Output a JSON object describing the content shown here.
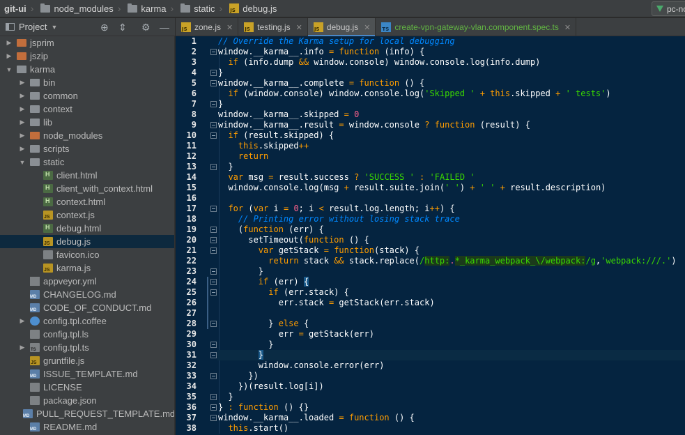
{
  "breadcrumb": [
    {
      "label": "git-ui",
      "icon": "folder-icon"
    },
    {
      "label": "node_modules",
      "icon": "folder-icon"
    },
    {
      "label": "karma",
      "icon": "folder-icon"
    },
    {
      "label": "static",
      "icon": "folder-icon"
    },
    {
      "label": "debug.js",
      "icon": "js-file-icon"
    }
  ],
  "run_config": {
    "label": "pc-node-e"
  },
  "project_panel": {
    "title": "Project",
    "tree": [
      {
        "label": "jsprim",
        "indent": 1,
        "arrow": "▶",
        "icon": "folder-orange"
      },
      {
        "label": "jszip",
        "indent": 1,
        "arrow": "▶",
        "icon": "folder-orange"
      },
      {
        "label": "karma",
        "indent": 1,
        "arrow": "▼",
        "icon": "folder-grey"
      },
      {
        "label": "bin",
        "indent": 2,
        "arrow": "▶",
        "icon": "folder-grey"
      },
      {
        "label": "common",
        "indent": 2,
        "arrow": "▶",
        "icon": "folder-grey"
      },
      {
        "label": "context",
        "indent": 2,
        "arrow": "▶",
        "icon": "folder-grey"
      },
      {
        "label": "lib",
        "indent": 2,
        "arrow": "▶",
        "icon": "folder-grey"
      },
      {
        "label": "node_modules",
        "indent": 2,
        "arrow": "▶",
        "icon": "folder-orange"
      },
      {
        "label": "scripts",
        "indent": 2,
        "arrow": "▶",
        "icon": "folder-grey"
      },
      {
        "label": "static",
        "indent": 2,
        "arrow": "▼",
        "icon": "folder-grey"
      },
      {
        "label": "client.html",
        "indent": 3,
        "arrow": "",
        "icon": "file-html"
      },
      {
        "label": "client_with_context.html",
        "indent": 3,
        "arrow": "",
        "icon": "file-html"
      },
      {
        "label": "context.html",
        "indent": 3,
        "arrow": "",
        "icon": "file-html"
      },
      {
        "label": "context.js",
        "indent": 3,
        "arrow": "",
        "icon": "file-js"
      },
      {
        "label": "debug.html",
        "indent": 3,
        "arrow": "",
        "icon": "file-html"
      },
      {
        "label": "debug.js",
        "indent": 3,
        "arrow": "",
        "icon": "file-js",
        "selected": true
      },
      {
        "label": "favicon.ico",
        "indent": 3,
        "arrow": "",
        "icon": "file-plain"
      },
      {
        "label": "karma.js",
        "indent": 3,
        "arrow": "",
        "icon": "file-js"
      },
      {
        "label": "appveyor.yml",
        "indent": 2,
        "arrow": "",
        "icon": "file-yml"
      },
      {
        "label": "CHANGELOG.md",
        "indent": 2,
        "arrow": "",
        "icon": "file-md"
      },
      {
        "label": "CODE_OF_CONDUCT.md",
        "indent": 2,
        "arrow": "",
        "icon": "file-md"
      },
      {
        "label": "config.tpl.coffee",
        "indent": 2,
        "arrow": "▶",
        "icon": "file-coffee"
      },
      {
        "label": "config.tpl.ls",
        "indent": 2,
        "arrow": "",
        "icon": "file-plain"
      },
      {
        "label": "config.tpl.ts",
        "indent": 2,
        "arrow": "▶",
        "icon": "file-ts"
      },
      {
        "label": "gruntfile.js",
        "indent": 2,
        "arrow": "",
        "icon": "file-js"
      },
      {
        "label": "ISSUE_TEMPLATE.md",
        "indent": 2,
        "arrow": "",
        "icon": "file-md"
      },
      {
        "label": "LICENSE",
        "indent": 2,
        "arrow": "",
        "icon": "file-plain"
      },
      {
        "label": "package.json",
        "indent": 2,
        "arrow": "",
        "icon": "file-json"
      },
      {
        "label": "PULL_REQUEST_TEMPLATE.md",
        "indent": 2,
        "arrow": "",
        "icon": "file-md"
      },
      {
        "label": "README.md",
        "indent": 2,
        "arrow": "",
        "icon": "file-md"
      }
    ]
  },
  "tabs": [
    {
      "label": "zone.js",
      "icon": "js",
      "active": false,
      "green": false
    },
    {
      "label": "testing.js",
      "icon": "js",
      "active": false,
      "green": false
    },
    {
      "label": "debug.js",
      "icon": "js",
      "active": true,
      "green": false
    },
    {
      "label": "create-vpn-gateway-vlan.component.spec.ts",
      "icon": "ts",
      "active": false,
      "green": true
    }
  ],
  "editor": {
    "line_numbers": [
      "1",
      "2",
      "3",
      "4",
      "5",
      "6",
      "7",
      "8",
      "9",
      "10",
      "11",
      "12",
      "13",
      "14",
      "15",
      "16",
      "17",
      "18",
      "19",
      "20",
      "21",
      "22",
      "23",
      "24",
      "25",
      "26",
      "27",
      "28",
      "29",
      "30",
      "31",
      "32",
      "33",
      "34",
      "35",
      "36",
      "37",
      "38"
    ],
    "current_line": 31,
    "fold_lines": [
      2,
      4,
      5,
      7,
      9,
      10,
      13,
      17,
      19,
      20,
      21,
      23,
      24,
      25,
      28,
      30,
      31,
      33,
      35,
      36,
      37
    ],
    "lines": [
      [
        [
          "c",
          "// Override the Karma setup for local debugging"
        ]
      ],
      [
        [
          "p",
          "window.__karma__.info "
        ],
        [
          "k",
          "="
        ],
        [
          "p",
          " "
        ],
        [
          "k",
          "function"
        ],
        [
          "p",
          " (info) {"
        ]
      ],
      [
        [
          "p",
          "  "
        ],
        [
          "k",
          "if"
        ],
        [
          "p",
          " (info.dump "
        ],
        [
          "k",
          "&&"
        ],
        [
          "p",
          " window.console) window.console.log(info.dump)"
        ]
      ],
      [
        [
          "p",
          "}"
        ]
      ],
      [
        [
          "p",
          "window.__karma__.complete "
        ],
        [
          "k",
          "="
        ],
        [
          "p",
          " "
        ],
        [
          "k",
          "function"
        ],
        [
          "p",
          " () {"
        ]
      ],
      [
        [
          "p",
          "  "
        ],
        [
          "k",
          "if"
        ],
        [
          "p",
          " (window.console) window.console.log("
        ],
        [
          "s",
          "'Skipped '"
        ],
        [
          "p",
          " "
        ],
        [
          "k",
          "+"
        ],
        [
          "p",
          " "
        ],
        [
          "k",
          "this"
        ],
        [
          "p",
          ".skipped "
        ],
        [
          "k",
          "+"
        ],
        [
          "p",
          " "
        ],
        [
          "s",
          "' tests'"
        ],
        [
          "p",
          ")"
        ]
      ],
      [
        [
          "p",
          "}"
        ]
      ],
      [
        [
          "p",
          "window.__karma__.skipped "
        ],
        [
          "k",
          "="
        ],
        [
          "p",
          " "
        ],
        [
          "n",
          "0"
        ]
      ],
      [
        [
          "p",
          "window.__karma__.result "
        ],
        [
          "k",
          "="
        ],
        [
          "p",
          " window.console "
        ],
        [
          "k",
          "?"
        ],
        [
          "p",
          " "
        ],
        [
          "k",
          "function"
        ],
        [
          "p",
          " (result) {"
        ]
      ],
      [
        [
          "p",
          "  "
        ],
        [
          "k",
          "if"
        ],
        [
          "p",
          " (result.skipped) {"
        ]
      ],
      [
        [
          "p",
          "    "
        ],
        [
          "k",
          "this"
        ],
        [
          "p",
          ".skipped"
        ],
        [
          "k",
          "++"
        ]
      ],
      [
        [
          "p",
          "    "
        ],
        [
          "k",
          "return"
        ]
      ],
      [
        [
          "p",
          "  }"
        ]
      ],
      [
        [
          "p",
          "  "
        ],
        [
          "k",
          "var"
        ],
        [
          "p",
          " msg "
        ],
        [
          "k",
          "="
        ],
        [
          "p",
          " result.success "
        ],
        [
          "k",
          "?"
        ],
        [
          "p",
          " "
        ],
        [
          "s",
          "'SUCCESS '"
        ],
        [
          "p",
          " "
        ],
        [
          "k",
          ":"
        ],
        [
          "p",
          " "
        ],
        [
          "s",
          "'FAILED '"
        ]
      ],
      [
        [
          "p",
          "  window.console.log(msg "
        ],
        [
          "k",
          "+"
        ],
        [
          "p",
          " result.suite.join("
        ],
        [
          "s",
          "' '"
        ],
        [
          "p",
          ") "
        ],
        [
          "k",
          "+"
        ],
        [
          "p",
          " "
        ],
        [
          "s",
          "' '"
        ],
        [
          "p",
          " "
        ],
        [
          "k",
          "+"
        ],
        [
          "p",
          " result.description)"
        ]
      ],
      [
        [
          "p",
          ""
        ]
      ],
      [
        [
          "p",
          "  "
        ],
        [
          "k",
          "for"
        ],
        [
          "p",
          " ("
        ],
        [
          "k",
          "var"
        ],
        [
          "p",
          " i "
        ],
        [
          "k",
          "="
        ],
        [
          "p",
          " "
        ],
        [
          "n",
          "0"
        ],
        [
          "p",
          "; i "
        ],
        [
          "k",
          "<"
        ],
        [
          "p",
          " result.log.length; i"
        ],
        [
          "k",
          "++"
        ],
        [
          "p",
          ") {"
        ]
      ],
      [
        [
          "p",
          "    "
        ],
        [
          "c",
          "// Printing error without losing stack trace"
        ]
      ],
      [
        [
          "p",
          "    ("
        ],
        [
          "k",
          "function"
        ],
        [
          "p",
          " (err) {"
        ]
      ],
      [
        [
          "p",
          "      setTimeout("
        ],
        [
          "k",
          "function"
        ],
        [
          "p",
          " () {"
        ]
      ],
      [
        [
          "p",
          "        "
        ],
        [
          "k",
          "var"
        ],
        [
          "p",
          " getStack "
        ],
        [
          "k",
          "="
        ],
        [
          "p",
          " "
        ],
        [
          "k",
          "function"
        ],
        [
          "p",
          "(stack) {"
        ]
      ],
      [
        [
          "p",
          "          "
        ],
        [
          "k",
          "return"
        ],
        [
          "p",
          " stack "
        ],
        [
          "k",
          "&&"
        ],
        [
          "p",
          " stack.replace("
        ],
        [
          "s",
          "/"
        ],
        [
          "rx",
          "http:"
        ],
        [
          "rxs",
          "."
        ],
        [
          "rx",
          "*"
        ],
        [
          "rx",
          "_karma_webpack_\\/webpack:"
        ],
        [
          "s",
          "/g"
        ],
        [
          "p",
          ","
        ],
        [
          "s",
          "'webpack:///.'"
        ],
        [
          "p",
          ")"
        ]
      ],
      [
        [
          "p",
          "        }"
        ]
      ],
      [
        [
          "p",
          "        "
        ],
        [
          "k",
          "if"
        ],
        [
          "p",
          " (err) "
        ],
        [
          "bm",
          "{"
        ]
      ],
      [
        [
          "p",
          "          "
        ],
        [
          "k",
          "if"
        ],
        [
          "p",
          " (err.stack) {"
        ]
      ],
      [
        [
          "p",
          "            err.stack "
        ],
        [
          "k",
          "="
        ],
        [
          "p",
          " getStack(err.stack)"
        ]
      ],
      [
        [
          "p",
          ""
        ]
      ],
      [
        [
          "p",
          "          } "
        ],
        [
          "k",
          "else"
        ],
        [
          "p",
          " {"
        ]
      ],
      [
        [
          "p",
          "            err "
        ],
        [
          "k",
          "="
        ],
        [
          "p",
          " getStack(err)"
        ]
      ],
      [
        [
          "p",
          "          }"
        ]
      ],
      [
        [
          "p",
          "        "
        ],
        [
          "bm",
          "}"
        ]
      ],
      [
        [
          "p",
          "        window.console.error(err)"
        ]
      ],
      [
        [
          "p",
          "      })"
        ]
      ],
      [
        [
          "p",
          "    })(result.log[i])"
        ]
      ],
      [
        [
          "p",
          "  }"
        ]
      ],
      [
        [
          "p",
          "} "
        ],
        [
          "k",
          ":"
        ],
        [
          "p",
          " "
        ],
        [
          "k",
          "function"
        ],
        [
          "p",
          " () {}"
        ]
      ],
      [
        [
          "p",
          "window.__karma__.loaded "
        ],
        [
          "k",
          "="
        ],
        [
          "p",
          " "
        ],
        [
          "k",
          "function"
        ],
        [
          "p",
          " () {"
        ]
      ],
      [
        [
          "p",
          "  "
        ],
        [
          "k",
          "this"
        ],
        [
          "p",
          ".start()"
        ]
      ]
    ]
  }
}
